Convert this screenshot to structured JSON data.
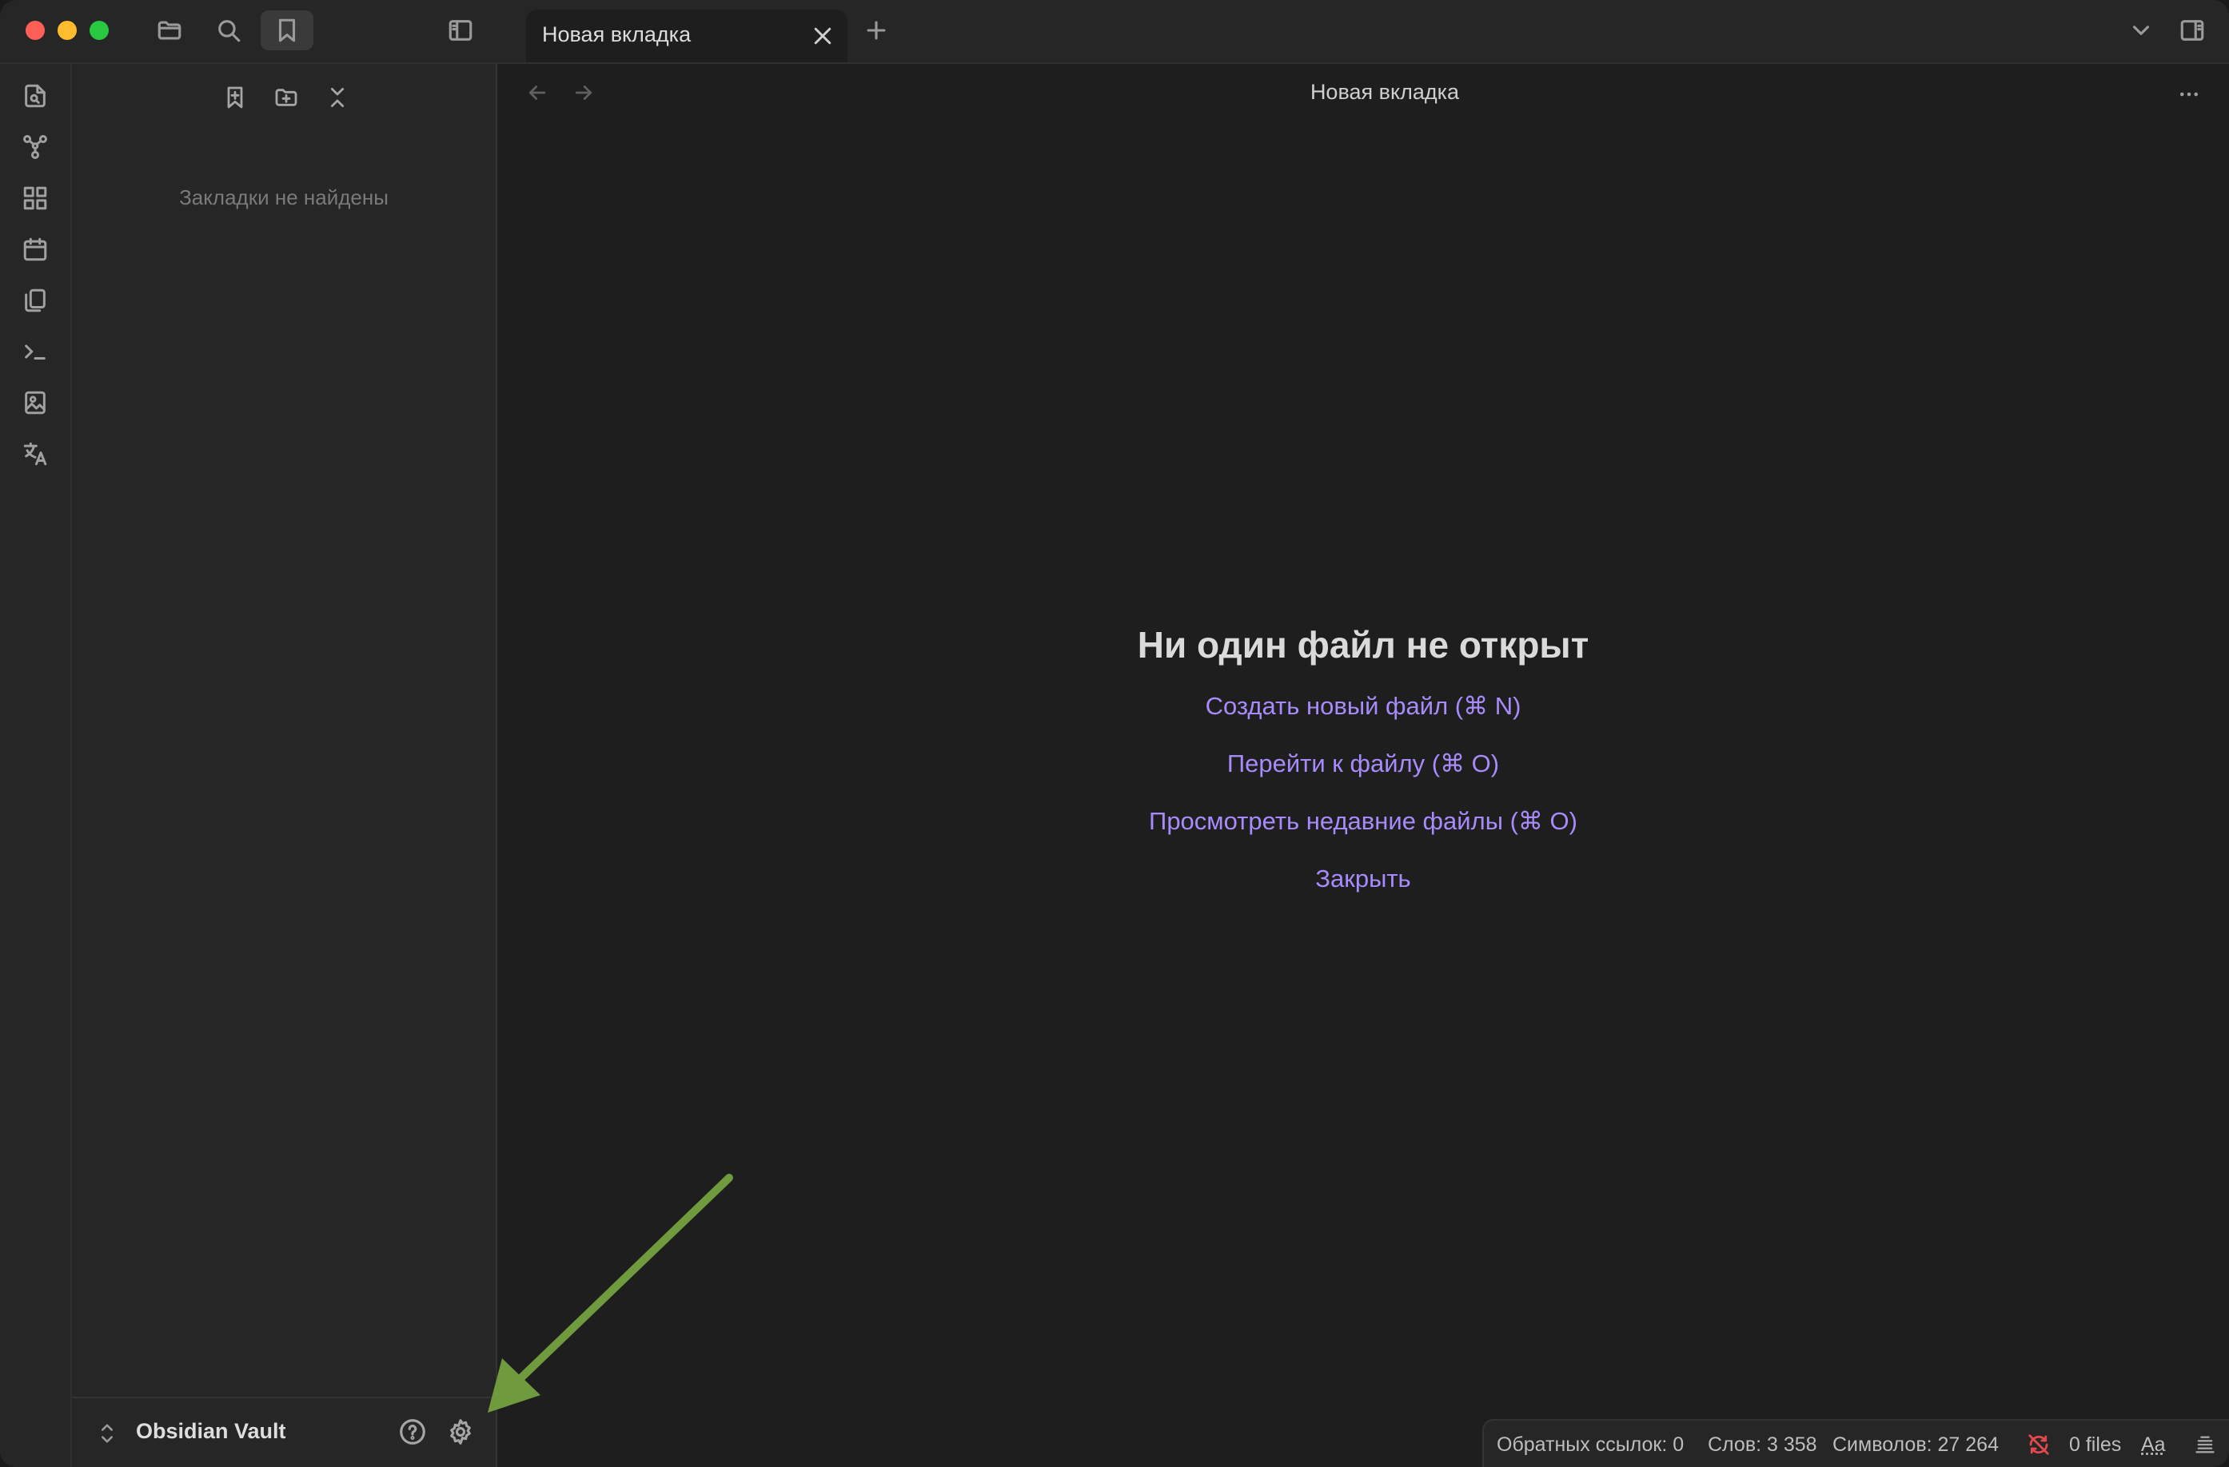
{
  "titlebar": {
    "tab_title": "Новая вкладка"
  },
  "sidebar": {
    "empty_message": "Закладки не найдены",
    "vault_name": "Obsidian Vault"
  },
  "main": {
    "view_title": "Новая вкладка",
    "empty_title": "Ни один файл не открыт",
    "actions": [
      "Создать новый файл (⌘ N)",
      "Перейти к файлу (⌘ O)",
      "Просмотреть недавние файлы (⌘ O)",
      "Закрыть"
    ]
  },
  "statusbar": {
    "backlinks": "Обратных ссылок: 0",
    "words": "Слов: 3 358",
    "chars": "Символов: 27 264",
    "files": "0 files",
    "font_toggle": "Aa"
  },
  "colors": {
    "accent": "#a88bfa",
    "annotation_arrow": "#6f9a3d",
    "sync_error": "#e5484d"
  },
  "icons": [
    "folder-icon",
    "search-icon",
    "bookmark-icon",
    "sidebar-toggle-icon",
    "plus-icon",
    "chevron-down-icon",
    "right-sidebar-icon",
    "new-note-icon",
    "graph-icon",
    "canvas-icon",
    "calendar-icon",
    "templates-icon",
    "terminal-icon",
    "image-icon",
    "translate-icon",
    "add-bookmark-icon",
    "new-folder-icon",
    "collapse-all-icon",
    "vault-switch-icon",
    "help-icon",
    "gear-icon",
    "back-arrow-icon",
    "forward-arrow-icon",
    "more-options-icon",
    "sync-off-icon",
    "list-icon"
  ]
}
